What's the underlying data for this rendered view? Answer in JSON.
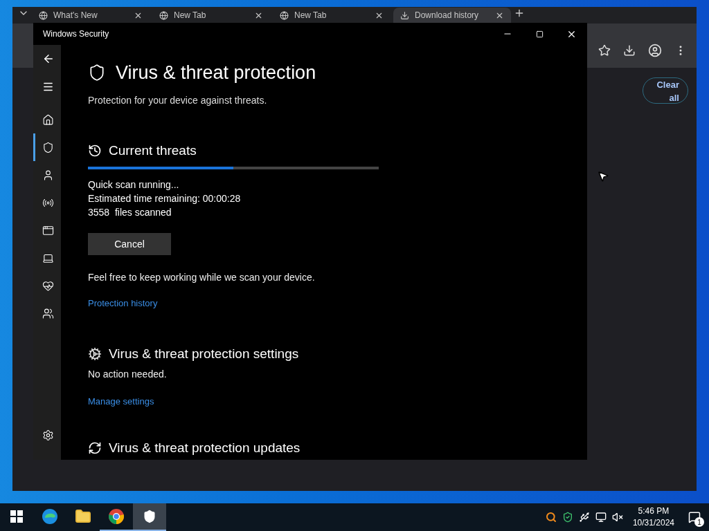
{
  "browser": {
    "tabs": [
      {
        "title": "What's New",
        "kind": "page",
        "selected": false
      },
      {
        "title": "New Tab",
        "kind": "page",
        "selected": false
      },
      {
        "title": "New Tab",
        "kind": "page",
        "selected": false
      },
      {
        "title": "Download history",
        "kind": "download",
        "selected": true
      }
    ],
    "clear_button": "Clear all"
  },
  "security_window": {
    "title": "Windows Security",
    "nav": [
      {
        "kind": "home",
        "selected": false
      },
      {
        "kind": "shield",
        "selected": true
      },
      {
        "kind": "account",
        "selected": false
      },
      {
        "kind": "network",
        "selected": false
      },
      {
        "kind": "app",
        "selected": false
      },
      {
        "kind": "device",
        "selected": false
      },
      {
        "kind": "health",
        "selected": false
      },
      {
        "kind": "family",
        "selected": false
      }
    ],
    "heading": "Virus & threat protection",
    "subtitle": "Protection for your device against threats.",
    "current_threats": {
      "heading": "Current threats",
      "level": 0.5,
      "status_lines": [
        "Quick scan running...",
        "Estimated time remaining: 00:00:28",
        "3558  files scanned"
      ],
      "cancel_button": "Cancel",
      "note": "Feel free to keep working while we scan your device.",
      "link": "Protection history"
    },
    "settings_section": {
      "heading": "Virus & threat protection settings",
      "status": "No action needed.",
      "link": "Manage settings"
    },
    "updates_section": {
      "heading": "Virus & threat protection updates"
    }
  },
  "taskbar": {
    "apps": [
      {
        "kind": "edge",
        "running": false,
        "selected": false
      },
      {
        "kind": "explorer",
        "running": false,
        "selected": false
      },
      {
        "kind": "chrome",
        "running": true,
        "selected": false
      },
      {
        "kind": "security",
        "running": true,
        "selected": true
      }
    ],
    "time": "5:46 PM",
    "date": "10/31/2024",
    "notification_count": "1"
  }
}
